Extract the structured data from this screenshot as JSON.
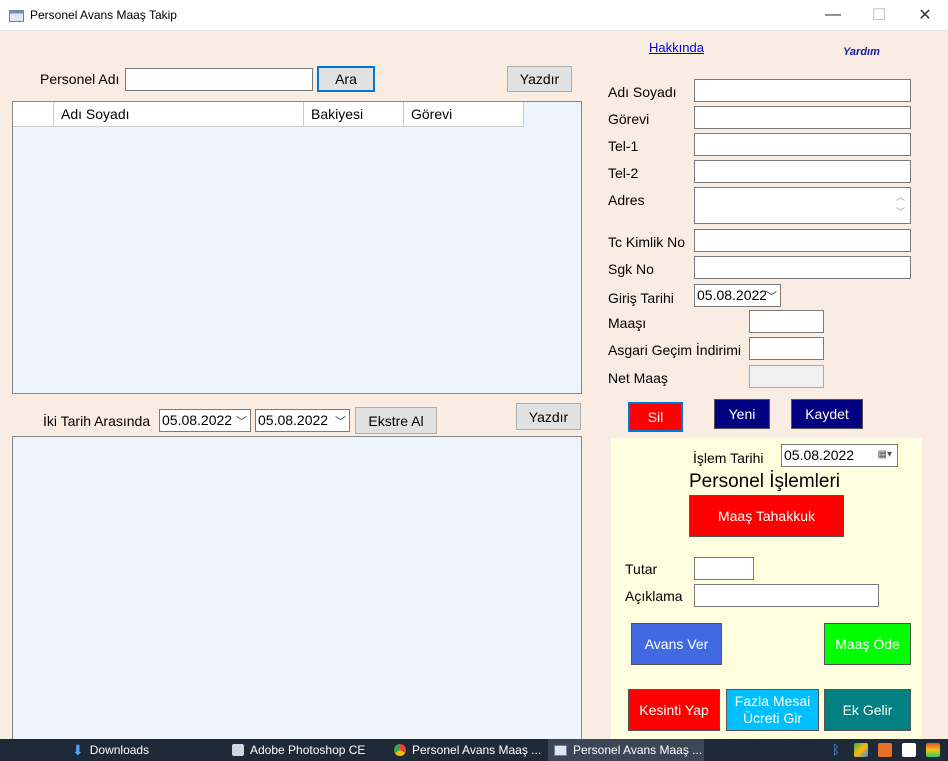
{
  "window": {
    "title": "Personel Avans Maaş Takip",
    "minimize": "—",
    "maximize": "☐",
    "close": "✕"
  },
  "search": {
    "label": "Personel Adı",
    "value": "",
    "button": "Ara",
    "print": "Yazdır"
  },
  "grid": {
    "columns": [
      "",
      "Adı Soyadı",
      "Bakiyesi",
      "Görevi"
    ]
  },
  "range": {
    "label": "İki Tarih Arasında",
    "from": "05.08.2022",
    "to": "05.08.2022",
    "extract_button": "Ekstre Al",
    "print": "Yazdır"
  },
  "links": {
    "about": "Hakkında",
    "help": "Yardım"
  },
  "form": {
    "name_label": "Adı Soyadı",
    "role_label": "Görevi",
    "tel1_label": "Tel-1",
    "tel2_label": "Tel-2",
    "address_label": "Adres",
    "tc_label": "Tc Kimlik No",
    "sgk_label": "Sgk No",
    "entry_date_label": "Giriş Tarihi",
    "entry_date_value": "05.08.2022",
    "salary_label": "Maaşı",
    "allowance_label": "Asgari Geçim İndirimi",
    "net_label": "Net Maaş"
  },
  "actions": {
    "delete": "Sil",
    "new": "Yeni",
    "save": "Kaydet"
  },
  "operations": {
    "date_label": "İşlem Tarihi",
    "date_value": "05.08.2022",
    "heading": "Personel İşlemleri",
    "accrual_button": "Maaş Tahakkuk",
    "amount_label": "Tutar",
    "desc_label": "Açıklama",
    "advance_button": "Avans Ver",
    "pay_button": "Maaş Öde",
    "deduct_button": "Kesinti Yap",
    "overtime_button": "Fazla Mesai Ücreti Gir",
    "extra_button": "Ek Gelir"
  },
  "taskbar": {
    "items": [
      "Downloads",
      "Adobe Photoshop CE",
      "Personel Avans Maaş ...",
      "Personel Avans Maaş ..."
    ]
  },
  "colors": {
    "red": "#ff0000",
    "navy": "#000080",
    "blue": "#4169e1",
    "green": "#00ff00",
    "cyan": "#00bfff",
    "teal": "#008080"
  }
}
